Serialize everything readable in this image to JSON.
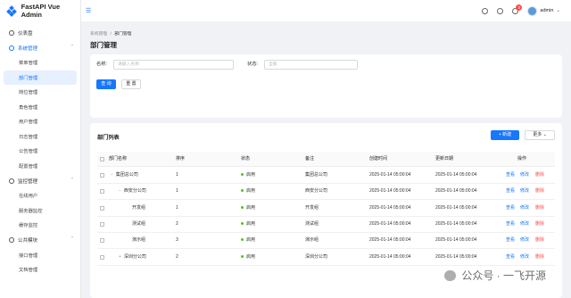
{
  "app": {
    "title": "FastAPI Vue Admin"
  },
  "sidebar": {
    "items": [
      {
        "label": "仪表盘",
        "icon": "dashboard-icon"
      },
      {
        "label": "系统管理",
        "icon": "settings-icon",
        "expanded": true,
        "children": [
          "菜单管理",
          "部门管理",
          "岗位管理",
          "角色管理",
          "用户管理",
          "日志管理",
          "公告管理",
          "配置管理"
        ]
      },
      {
        "label": "监控管理",
        "icon": "monitor-icon",
        "expanded": true,
        "children": [
          "在线用户",
          "服务器监控",
          "缓存监控"
        ]
      },
      {
        "label": "公共模块",
        "icon": "module-icon",
        "expanded": true,
        "children": [
          "接口管理",
          "文档管理"
        ]
      }
    ],
    "active": "部门管理"
  },
  "header": {
    "user": "admin",
    "notification_count": "3"
  },
  "breadcrumb": {
    "root": "系统管理",
    "separator": "/",
    "current": "部门管理"
  },
  "page_title": "部门管理",
  "search": {
    "name_label": "名称:",
    "name_placeholder": "请输入名称",
    "status_label": "状态:",
    "status_placeholder": "全部",
    "query_label": "查 询",
    "reset_label": "重 置"
  },
  "table": {
    "title": "部门列表",
    "add_label": "+ 新建",
    "more_label": "更多",
    "columns": [
      "部门名称",
      "排序",
      "状态",
      "备注",
      "创建时间",
      "更新日期",
      "操作"
    ],
    "rows": [
      {
        "name": "集团总公司",
        "tree": "−",
        "indent": 0,
        "order": "1",
        "status": "启用",
        "remark": "集团总公司",
        "created": "2025-01-14 05:00:04",
        "updated": "2025-01-14 05:00:04"
      },
      {
        "name": "西安分公司",
        "tree": "−",
        "indent": 1,
        "order": "1",
        "status": "启用",
        "remark": "西安分公司",
        "created": "2025-01-14 05:00:04",
        "updated": "2025-01-14 05:00:04"
      },
      {
        "name": "开发组",
        "tree": "",
        "indent": 2,
        "order": "1",
        "status": "启用",
        "remark": "开发组",
        "created": "2025-01-14 05:00:04",
        "updated": "2025-01-14 05:00:04"
      },
      {
        "name": "测试组",
        "tree": "",
        "indent": 2,
        "order": "2",
        "status": "启用",
        "remark": "测试组",
        "created": "2025-01-14 05:00:04",
        "updated": "2025-01-14 05:00:04"
      },
      {
        "name": "演示组",
        "tree": "",
        "indent": 2,
        "order": "3",
        "status": "启用",
        "remark": "演示组",
        "created": "2025-01-14 05:00:04",
        "updated": "2025-01-14 05:00:04"
      },
      {
        "name": "深圳分公司",
        "tree": "+",
        "indent": 1,
        "order": "2",
        "status": "启用",
        "remark": "深圳分公司",
        "created": "2025-01-14 05:00:04",
        "updated": "2025-01-14 05:00:04"
      }
    ],
    "actions": [
      "查看",
      "修改",
      "删除"
    ]
  },
  "watermark": "公众号 · 一飞开源",
  "colors": {
    "primary": "#1677ff",
    "danger": "#ff4d4f",
    "success": "#52c41a"
  }
}
